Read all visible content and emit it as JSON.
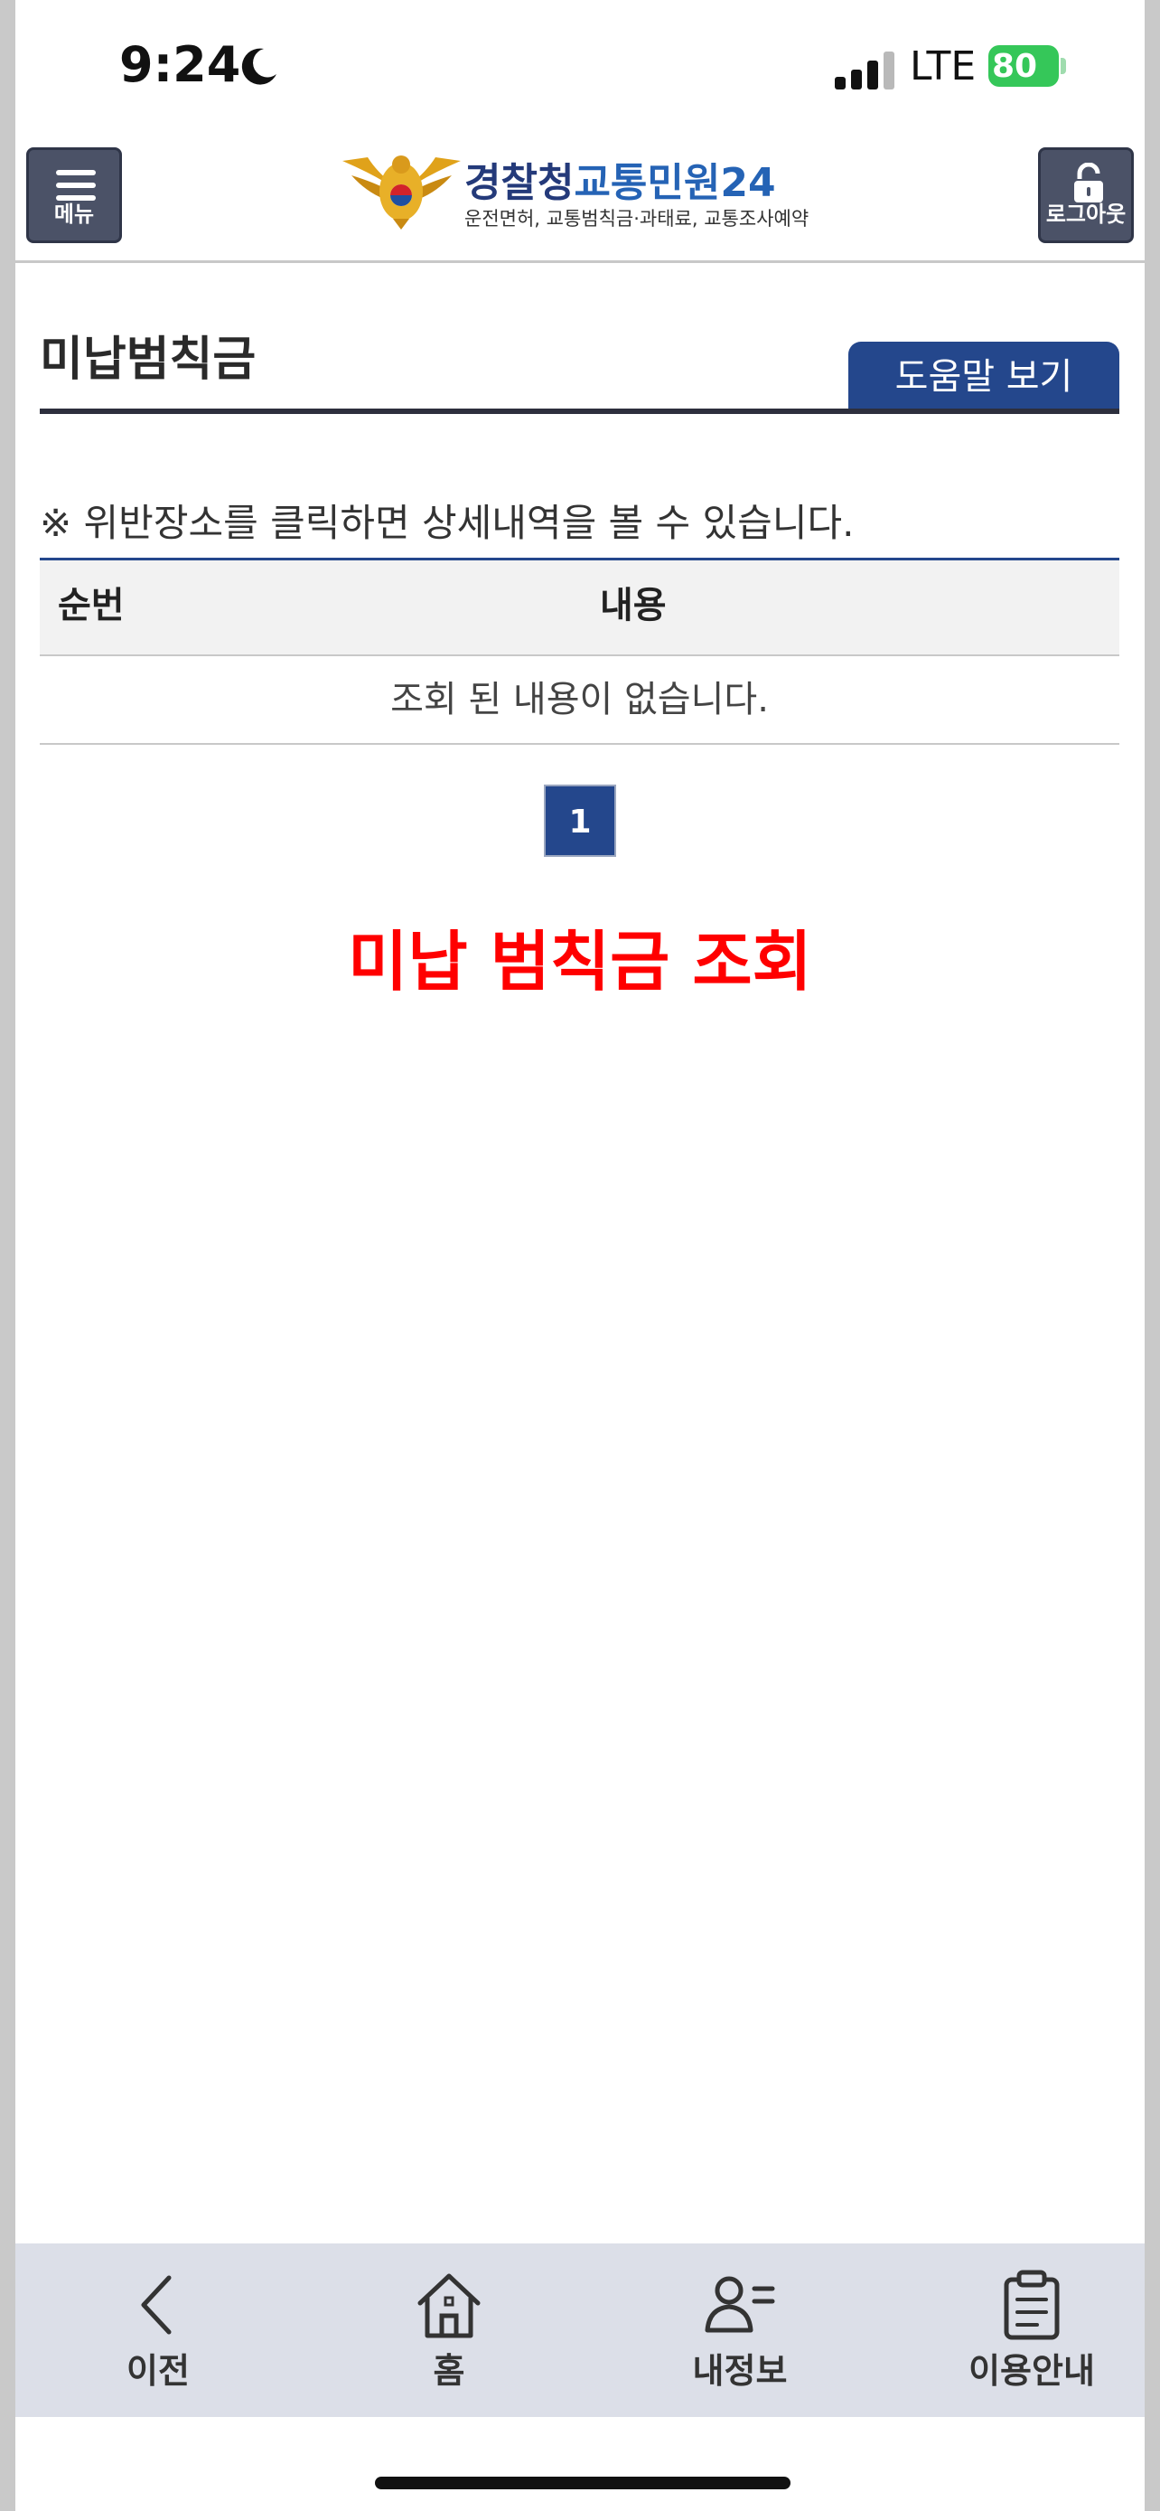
{
  "status": {
    "time": "9:24",
    "network": "LTE",
    "battery": "80"
  },
  "header": {
    "menu_label": "메뉴",
    "brand_main": "경찰청",
    "brand_sub": "교통민원24",
    "tagline": "운전면허, 교통범칙금·과태료, 교통조사예약",
    "logout_label": "로그아웃"
  },
  "page": {
    "title": "미납범칙금",
    "help_button": "도움말 보기",
    "notice": "※ 위반장소를 클릭하면 상세내역을 볼 수 있습니다.",
    "table": {
      "columns": [
        "순번",
        "내용"
      ],
      "empty_message": "조회 된 내용이 없습니다."
    },
    "pagination": {
      "current": "1"
    },
    "caption": "미납 범칙금 조회"
  },
  "bottom_nav": {
    "items": [
      {
        "label": "이전",
        "icon": "chevron-left-icon"
      },
      {
        "label": "홈",
        "icon": "home-icon"
      },
      {
        "label": "내정보",
        "icon": "user-info-icon"
      },
      {
        "label": "이용안내",
        "icon": "clipboard-icon"
      }
    ]
  },
  "colors": {
    "primary": "#24478c",
    "caption": "#ff0000",
    "battery": "#35c759"
  }
}
